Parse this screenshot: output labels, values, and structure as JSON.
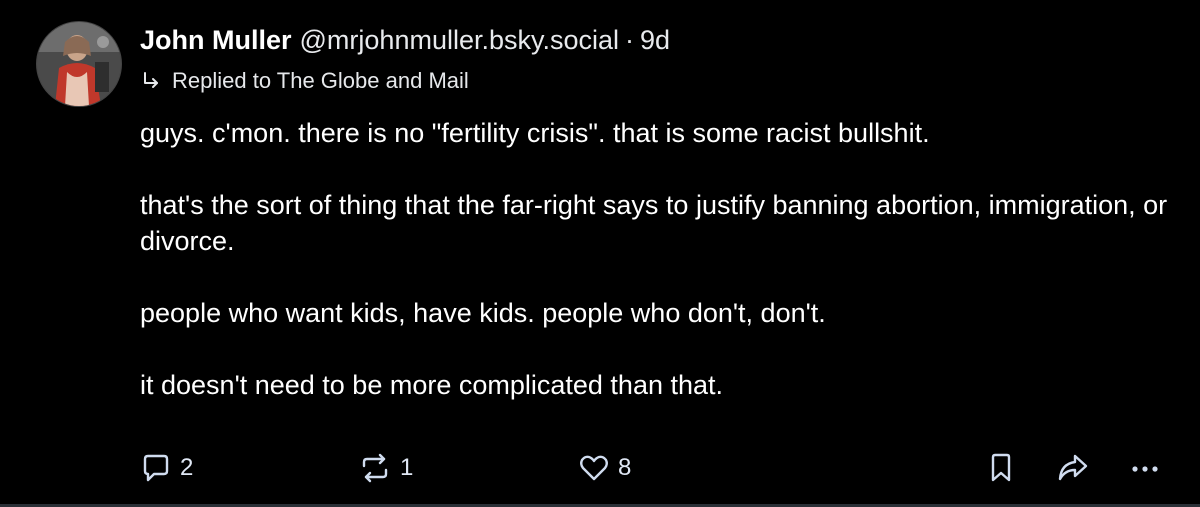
{
  "post": {
    "author": {
      "display_name": "John Muller",
      "handle": "@mrjohnmuller.bsky.social",
      "separator": "·",
      "age": "9d",
      "avatar_icon": "user-avatar"
    },
    "reply_context": {
      "label": "Replied to The Globe and Mail",
      "icon": "reply-arrow-icon"
    },
    "paragraphs": [
      "guys. c'mon. there is no \"fertility crisis\". that is some racist bullshit.",
      "that's the sort of thing that the far-right says to justify banning abortion, immigration, or divorce.",
      "people who want kids, have kids. people who don't, don't.",
      "it doesn't need to be more complicated than that."
    ],
    "actions": {
      "replies": "2",
      "reposts": "1",
      "likes": "8"
    }
  },
  "colors": {
    "background": "#000000",
    "text": "#ffffff",
    "icon": "#d0dcef"
  }
}
